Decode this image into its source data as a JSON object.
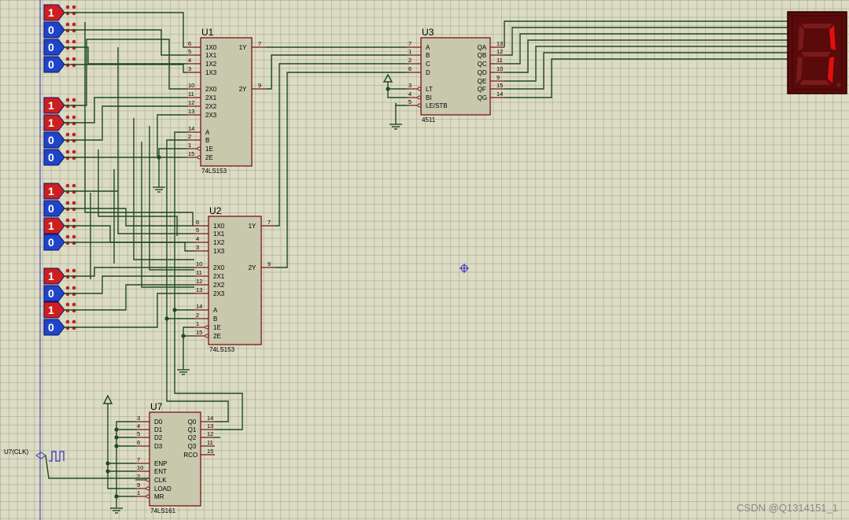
{
  "logic_states": [
    "1",
    "0",
    "0",
    "0",
    "1",
    "1",
    "0",
    "0",
    "1",
    "0",
    "1",
    "0",
    "1",
    "0",
    "1",
    "0"
  ],
  "state_colors": {
    "high": "#cc1f1f",
    "low": "#1e44c8"
  },
  "chips": {
    "u1": {
      "name": "U1",
      "part": "74LS153",
      "left_pins": [
        [
          "6",
          "1X0"
        ],
        [
          "5",
          "1X1"
        ],
        [
          "4",
          "1X2"
        ],
        [
          "3",
          "1X3"
        ],
        [
          "10",
          "2X0"
        ],
        [
          "11",
          "2X1"
        ],
        [
          "12",
          "2X2"
        ],
        [
          "13",
          "2X3"
        ],
        [
          "14",
          "A"
        ],
        [
          "2",
          "B"
        ],
        [
          "1",
          "1E"
        ],
        [
          "15",
          "2E"
        ]
      ],
      "right_pins": [
        [
          "7",
          "1Y"
        ],
        [
          "9",
          "2Y"
        ]
      ]
    },
    "u2": {
      "name": "U2",
      "part": "74LS153",
      "left_pins": [
        [
          "6",
          "1X0"
        ],
        [
          "5",
          "1X1"
        ],
        [
          "4",
          "1X2"
        ],
        [
          "3",
          "1X3"
        ],
        [
          "10",
          "2X0"
        ],
        [
          "11",
          "2X1"
        ],
        [
          "12",
          "2X2"
        ],
        [
          "13",
          "2X3"
        ],
        [
          "14",
          "A"
        ],
        [
          "2",
          "B"
        ],
        [
          "1",
          "1E"
        ],
        [
          "15",
          "2E"
        ]
      ],
      "right_pins": [
        [
          "7",
          "1Y"
        ],
        [
          "9",
          "2Y"
        ]
      ]
    },
    "u3": {
      "name": "U3",
      "part": "4511",
      "left_pins": [
        [
          "7",
          "A"
        ],
        [
          "1",
          "B"
        ],
        [
          "2",
          "C"
        ],
        [
          "6",
          "D"
        ],
        [
          "3",
          "LT"
        ],
        [
          "4",
          "BI"
        ],
        [
          "5",
          "LE/STB"
        ]
      ],
      "right_pins": [
        [
          "13",
          "QA"
        ],
        [
          "12",
          "QB"
        ],
        [
          "11",
          "QC"
        ],
        [
          "10",
          "QD"
        ],
        [
          "9",
          "QE"
        ],
        [
          "15",
          "QF"
        ],
        [
          "14",
          "QG"
        ]
      ]
    },
    "u7": {
      "name": "U7",
      "part": "74LS161",
      "left_pins": [
        [
          "3",
          "D0"
        ],
        [
          "4",
          "D1"
        ],
        [
          "5",
          "D2"
        ],
        [
          "6",
          "D3"
        ],
        [
          "7",
          "ENP"
        ],
        [
          "10",
          "ENT"
        ],
        [
          "2",
          "CLK"
        ],
        [
          "9",
          "LOAD"
        ],
        [
          "1",
          "MR"
        ]
      ],
      "right_pins": [
        [
          "14",
          "Q0"
        ],
        [
          "13",
          "Q1"
        ],
        [
          "12",
          "Q2"
        ],
        [
          "11",
          "Q3"
        ],
        [
          "15",
          "RCO"
        ]
      ]
    }
  },
  "clock_label": "U7(CLK)",
  "display": {
    "segment_color": "#e01010",
    "body_color": "#5a0a0a"
  },
  "watermark": "CSDN @Q1314151_1"
}
